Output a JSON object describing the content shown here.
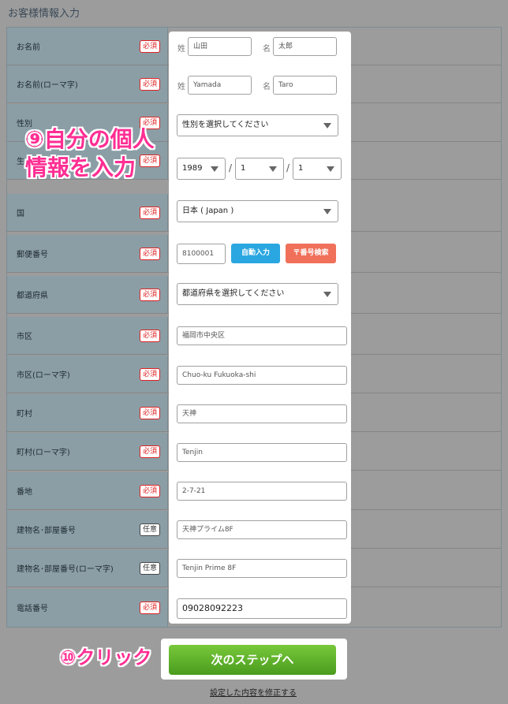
{
  "page_title": "お客様情報入力",
  "badges": {
    "required": "必須",
    "optional": "任意"
  },
  "rows": [
    {
      "label": "お名前",
      "badge": "必須"
    },
    {
      "label": "お名前(ローマ字)",
      "badge": "必須"
    },
    {
      "label": "性別",
      "badge": "必須"
    },
    {
      "label": "生",
      "badge": "必須"
    },
    {
      "label": "国",
      "badge": "必須"
    },
    {
      "label": "郵便番号",
      "badge": "必須"
    },
    {
      "label": "都道府県",
      "badge": "必須"
    },
    {
      "label": "市区",
      "badge": "必須"
    },
    {
      "label": "市区(ローマ字)",
      "badge": "必須"
    },
    {
      "label": "町村",
      "badge": "必須"
    },
    {
      "label": "町村(ローマ字)",
      "badge": "必須"
    },
    {
      "label": "番地",
      "badge": "必須"
    },
    {
      "label": "建物名･部屋番号",
      "badge": "任意"
    },
    {
      "label": "建物名･部屋番号(ローマ字)",
      "badge": "任意"
    },
    {
      "label": "電話番号",
      "badge": "必須"
    }
  ],
  "fields": {
    "sei_label": "姓",
    "mei_label": "名",
    "sei": "山田",
    "mei": "太郎",
    "sei_roman": "Yamada",
    "mei_roman": "Taro",
    "gender": "性別を選択してください",
    "birth_year": "1989",
    "birth_month": "1",
    "birth_day": "1",
    "date_sep": "/",
    "country": "日本 ( Japan )",
    "postal": "8100001",
    "prefecture": "都道府県を選択してください",
    "city": "福岡市中央区",
    "city_roman": "Chuo-ku Fukuoka-shi",
    "town": "天神",
    "town_roman": "Tenjin",
    "address": "2-7-21",
    "building": "天神プライム8F",
    "building_roman": "Tenjin Prime 8F",
    "phone": "09028092223"
  },
  "buttons": {
    "auto_fill": "自動入力",
    "postal_search": "〒番号検索",
    "next_step": "次のステップへ",
    "modify_link": "設定した内容を修正する"
  },
  "annotations": {
    "step9_line1": "⑨自分の個人",
    "step9_line2": "情報を入力",
    "step10": "⑩クリック"
  },
  "colors": {
    "accent_pink": "#ff2e93",
    "next_green": "#5aad28",
    "auto_blue": "#2aa7e0",
    "search_red": "#f0705a",
    "required_red": "#dd2222"
  }
}
